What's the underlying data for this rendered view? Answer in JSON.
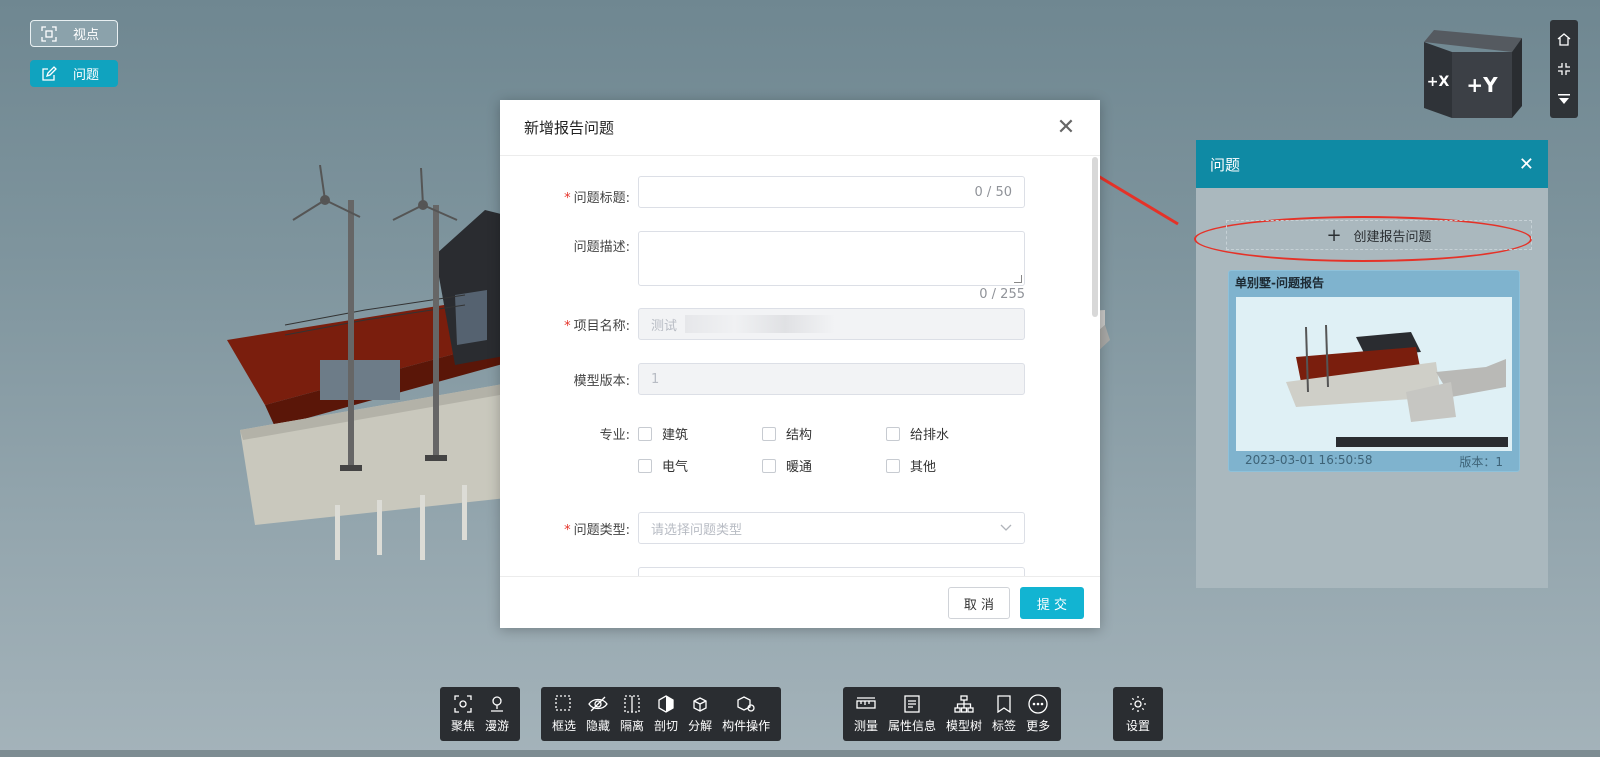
{
  "top_buttons": {
    "viewpoint": "视点",
    "issue": "问题"
  },
  "right_tools": [
    "home-icon",
    "fit-icon",
    "collapse-icon"
  ],
  "view_cube": {
    "x_face": "+X",
    "y_face": "+Y"
  },
  "issue_panel": {
    "title": "问题",
    "create_label": "创建报告问题",
    "card": {
      "title": "单别墅-问题报告",
      "date": "2023-03-01 16:50:58",
      "version": "版本：1"
    }
  },
  "modal": {
    "title": "新增报告问题",
    "fields": {
      "issue_title": {
        "label": "问题标题:",
        "counter": "0 / 50"
      },
      "issue_desc": {
        "label": "问题描述:",
        "counter": "0 / 255"
      },
      "project_name": {
        "label": "项目名称:",
        "value": "测试"
      },
      "model_version": {
        "label": "模型版本:",
        "value": "1"
      },
      "discipline": {
        "label": "专业:",
        "options": [
          "建筑",
          "结构",
          "给排水",
          "电气",
          "暖通",
          "其他"
        ]
      },
      "issue_type": {
        "label": "问题类型:",
        "placeholder": "请选择问题类型"
      }
    },
    "cancel_label": "取 消",
    "submit_label": "提 交"
  },
  "toolbar": {
    "group1": [
      "聚焦",
      "漫游"
    ],
    "group2": [
      "框选",
      "隐藏",
      "隔离",
      "剖切",
      "分解",
      "构件操作"
    ],
    "group3": [
      "测量",
      "属性信息",
      "模型树",
      "标签",
      "更多"
    ],
    "group4": [
      "设置"
    ]
  },
  "colors": {
    "accent": "#10a3bf",
    "required": "#e53228",
    "toolbar_bg": "#2a2d31"
  }
}
